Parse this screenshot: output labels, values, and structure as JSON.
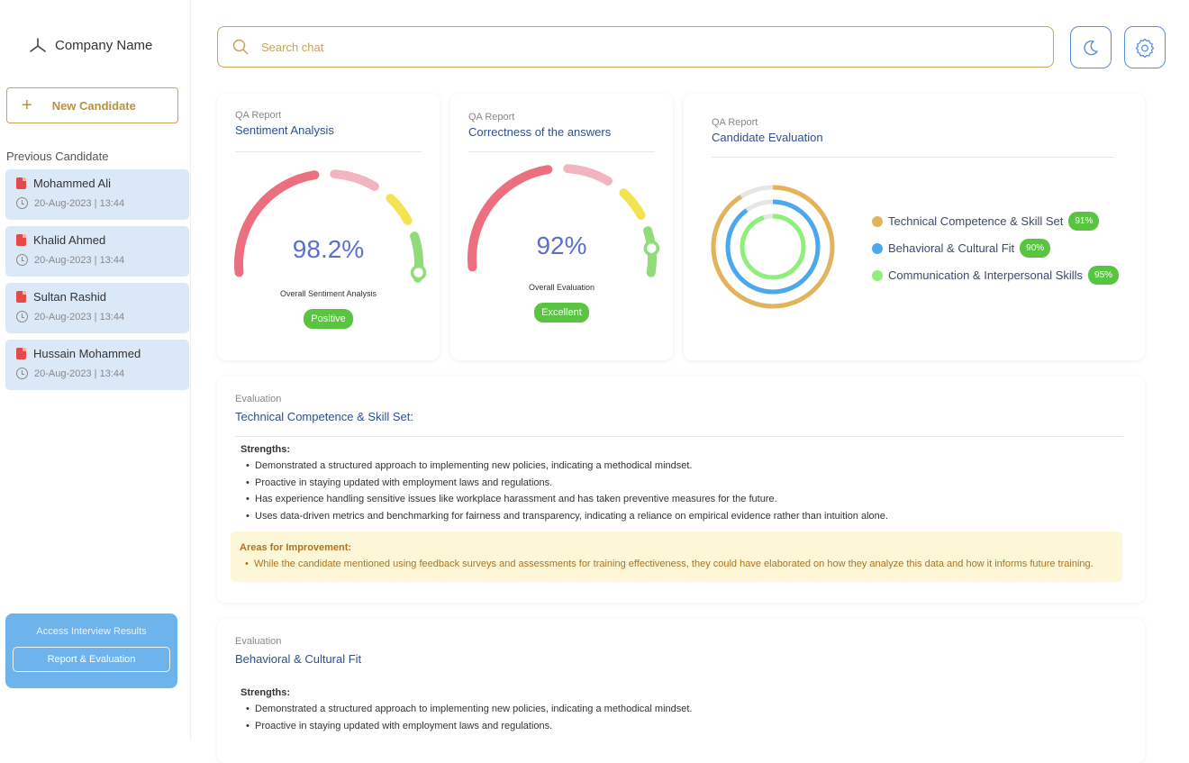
{
  "sidebar": {
    "company_name": "Company Name",
    "new_candidate_label": "New Candidate",
    "previous_title": "Previous Candidate",
    "candidates": [
      {
        "name": "Mohammed Ali",
        "date": "20-Aug-2023 | 13:44"
      },
      {
        "name": "Khalid Ahmed",
        "date": "20-Aug-2023 | 13:44"
      },
      {
        "name": "Sultan Rashid",
        "date": "20-Aug-2023 | 13:44"
      },
      {
        "name": "Hussain Mohammed",
        "date": "20-Aug-2023 | 13:44"
      }
    ],
    "access_text": "Access Interview Results",
    "report_button": "Report & Evaluation"
  },
  "header": {
    "search_placeholder": "Search chat",
    "theme_icon": "moon-icon",
    "settings_icon": "gear-icon"
  },
  "cards": {
    "sentiment": {
      "kicker": "QA Report",
      "title": "Sentiment Analysis",
      "value": "98.2%",
      "level": 0.982,
      "subtitle": "Overall Sentiment Analysis",
      "badge": "Positive"
    },
    "correctness": {
      "kicker": "QA Report",
      "title": "Correctness of the answers",
      "value": "92%",
      "level": 0.92,
      "subtitle": "Overall Evaluation",
      "badge": "Excellent"
    },
    "candidate_eval": {
      "kicker": "QA Report",
      "title": "Candidate Evaluation",
      "items": [
        {
          "label": "Technical Competence & Skill Set",
          "pct": "91%",
          "value": 91,
          "color": "#e3b35c"
        },
        {
          "label": "Behavioral & Cultural Fit",
          "pct": "90%",
          "value": 90,
          "color": "#4aa8ee"
        },
        {
          "label": "Communication & Interpersonal Skills",
          "pct": "95%",
          "value": 95,
          "color": "#8ef07a"
        }
      ]
    }
  },
  "evaluations": [
    {
      "kicker": "Evaluation",
      "title": "Technical Competence & Skill Set:",
      "strengths_title": "Strengths:",
      "strengths": [
        "Demonstrated a structured approach to implementing new policies, indicating a methodical mindset.",
        "Proactive in staying updated with employment laws and regulations.",
        "Has experience handling sensitive issues like workplace harassment and has taken preventive measures for the future.",
        "Uses data-driven metrics and benchmarking for fairness and transparency, indicating a reliance on empirical evidence rather than intuition alone."
      ],
      "improve_title": "Areas for Improvement:",
      "improvements": [
        "While the candidate mentioned using feedback surveys and assessments for training effectiveness, they could have elaborated on how they analyze this data and how it informs future training."
      ]
    },
    {
      "kicker": "Evaluation",
      "title": "Behavioral & Cultural Fit",
      "strengths_title": "Strengths:",
      "strengths": [
        "Demonstrated a structured approach to implementing new policies, indicating a methodical mindset.",
        "Proactive in staying updated with employment laws and regulations."
      ]
    }
  ],
  "colors": {
    "accent_gold": "#c9a35a",
    "accent_blue": "#5a8fd6",
    "gauge_red": "#ec6f7f",
    "gauge_pink": "#f2b5c0",
    "gauge_yellow": "#f4e350",
    "gauge_green": "#8fdc79",
    "badge_green": "#58c43f"
  }
}
